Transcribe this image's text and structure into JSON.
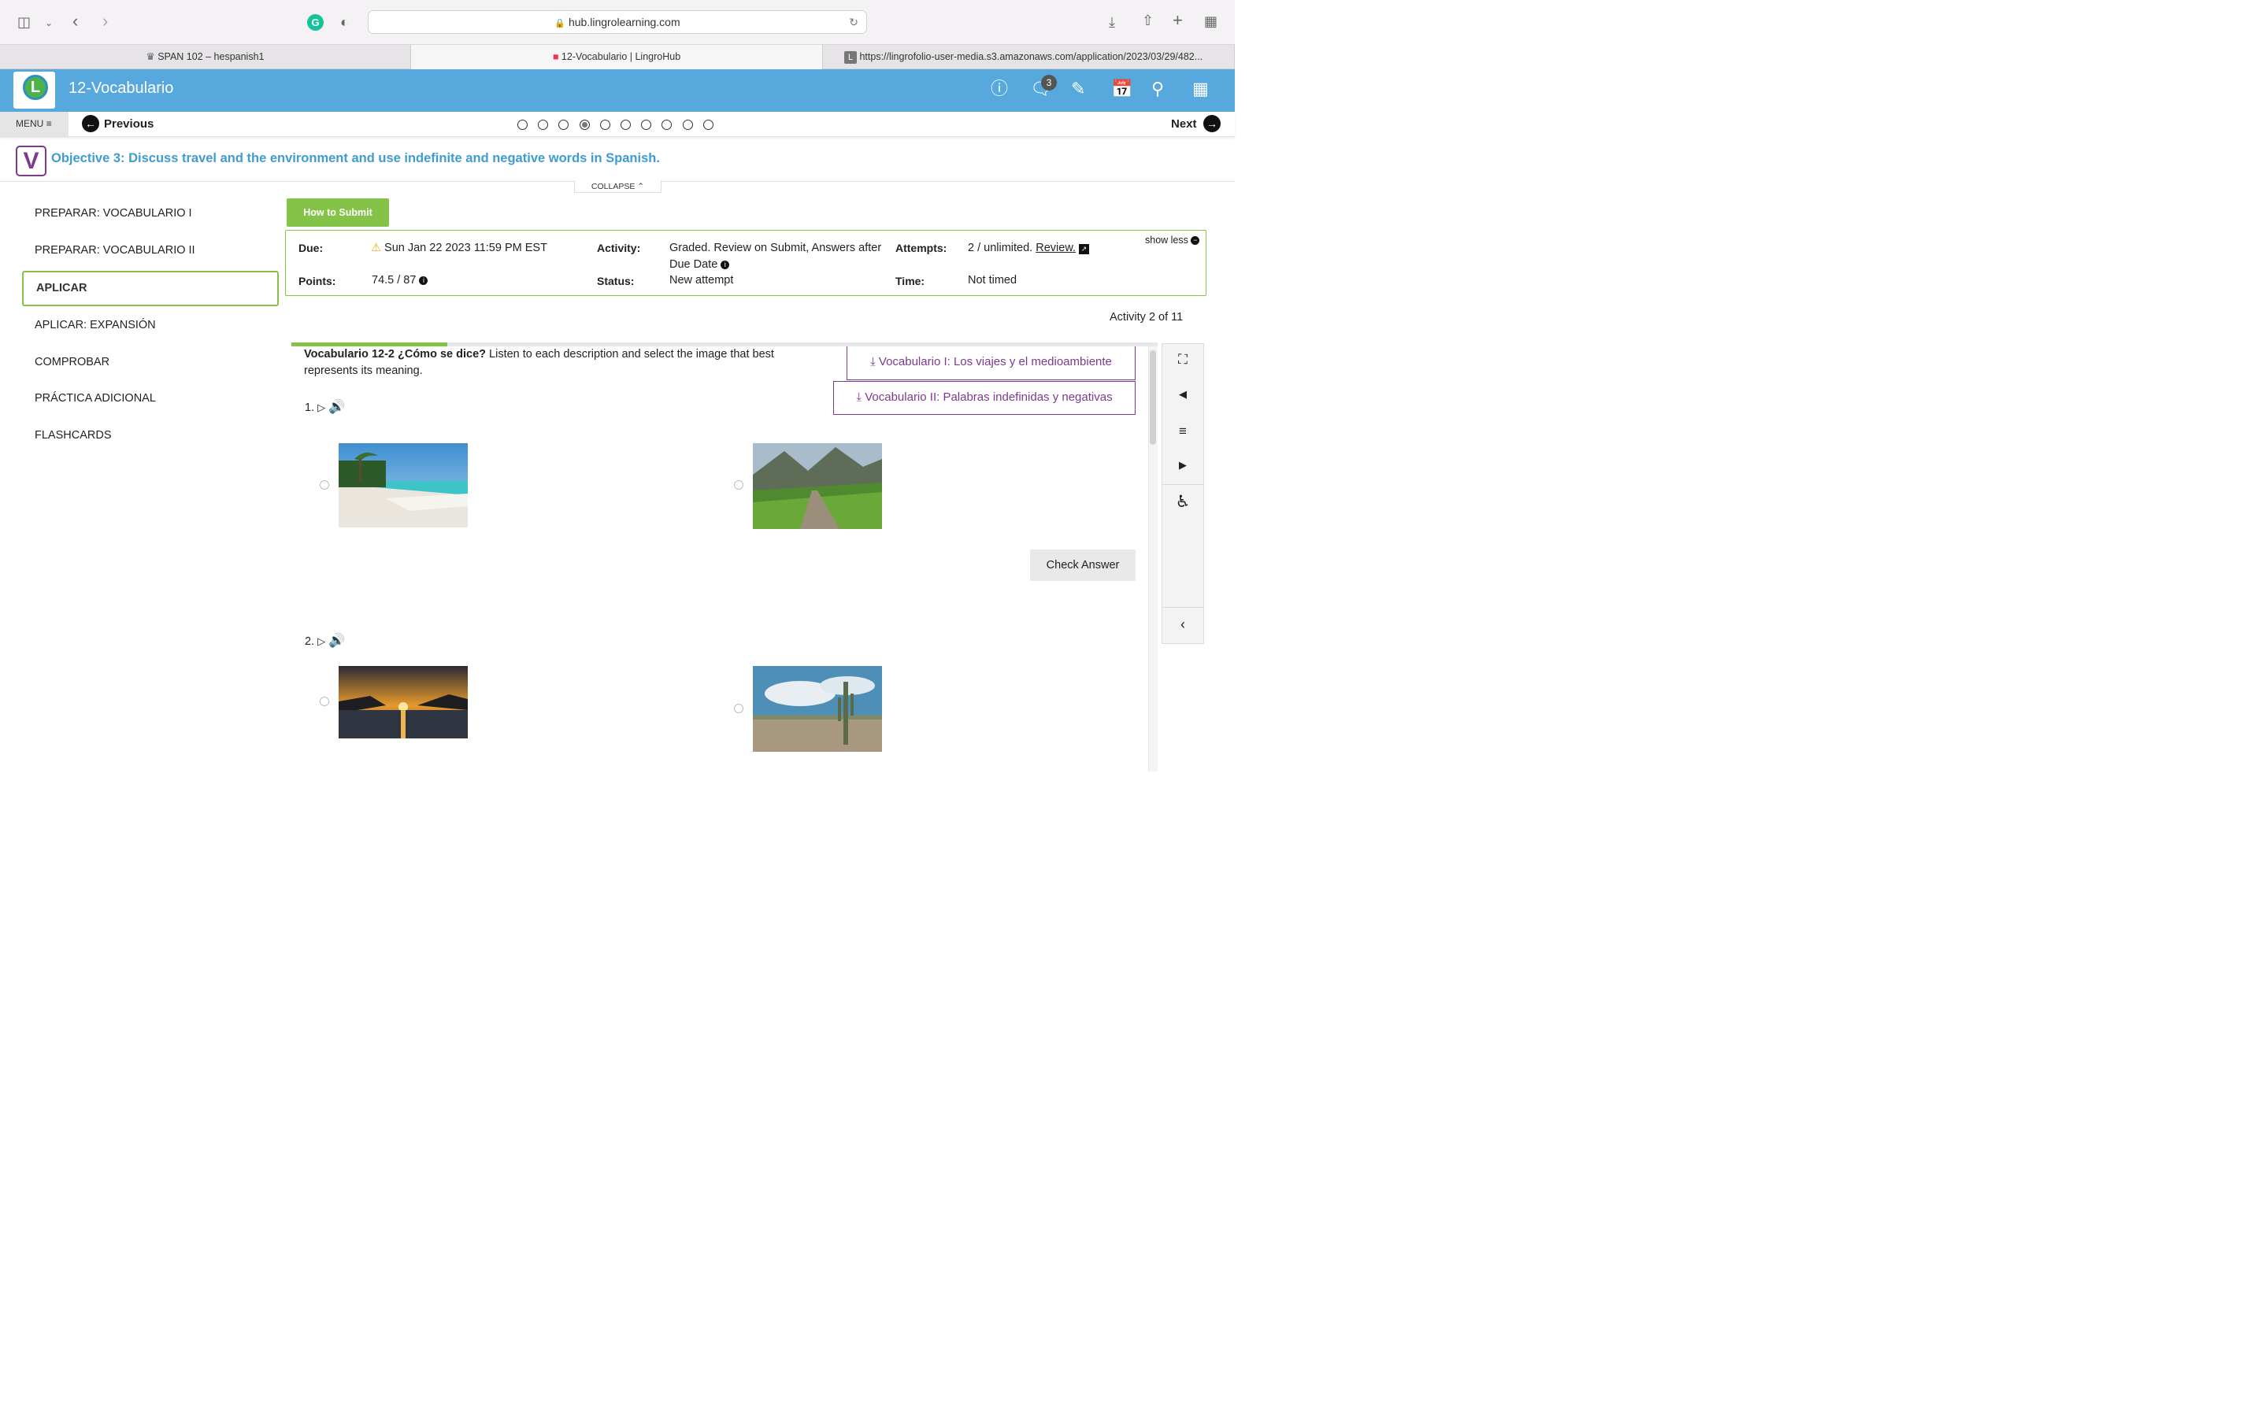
{
  "browser": {
    "url": "hub.lingrolearning.com",
    "tabs": [
      {
        "label": "SPAN 102 – hespanish1"
      },
      {
        "label": "12-Vocabulario | LingroHub"
      },
      {
        "label": "https://lingrofolio-user-media.s3.amazonaws.com/application/2023/03/29/482..."
      }
    ]
  },
  "header": {
    "title": "12-Vocabulario",
    "logo_letter": "L",
    "notification_count": "3"
  },
  "nav": {
    "menu_label": "MENU",
    "previous_label": "Previous",
    "next_label": "Next",
    "page_count": 10,
    "current_page": 4
  },
  "objective": {
    "badge_letter": "V",
    "text": "Objective 3: Discuss travel and the environment and use indefinite and negative words in Spanish.",
    "collapse_label": "COLLAPSE"
  },
  "sidebar": {
    "items": [
      {
        "label": "PREPARAR: VOCABULARIO I"
      },
      {
        "label": "PREPARAR: VOCABULARIO II"
      },
      {
        "label": "APLICAR"
      },
      {
        "label": "APLICAR: EXPANSIÓN"
      },
      {
        "label": "COMPROBAR"
      },
      {
        "label": "PRÁCTICA ADICIONAL"
      },
      {
        "label": "FLASHCARDS"
      }
    ],
    "active_index": 2
  },
  "content": {
    "how_to_submit": "How to Submit",
    "info": {
      "due_label": "Due:",
      "due_value": "Sun Jan 22 2023 11:59 PM EST",
      "points_label": "Points:",
      "points_value": "74.5 / 87",
      "activity_label": "Activity:",
      "activity_value_1": "Graded. Review on Submit, Answers after",
      "activity_value_2": "Due Date",
      "status_label": "Status:",
      "status_value": "New attempt",
      "attempts_label": "Attempts:",
      "attempts_value": "2 / unlimited.",
      "review_link": "Review.",
      "time_label": "Time:",
      "time_value": "Not timed",
      "show_less": "show less"
    },
    "activity_count": "Activity 2 of 11",
    "progress_fraction": 0.18
  },
  "activity": {
    "intro_bold": "Vocabulario 12-2 ¿Cómo se dice?",
    "intro_text": " Listen to each description and select the image that best represents its meaning.",
    "vocab_buttons": [
      {
        "label": "Vocabulario I: Los viajes y el medioambiente"
      },
      {
        "label": "Vocabulario II: Palabras indefinidas y negativas"
      }
    ],
    "questions": [
      {
        "number": "1."
      },
      {
        "number": "2."
      }
    ],
    "check_answer": "Check Answer"
  },
  "colors": {
    "header_blue": "#57a9dd",
    "accent_green": "#85c348",
    "objective_blue": "#3f9cd3",
    "vocab_purple": "#7c3a8c"
  }
}
